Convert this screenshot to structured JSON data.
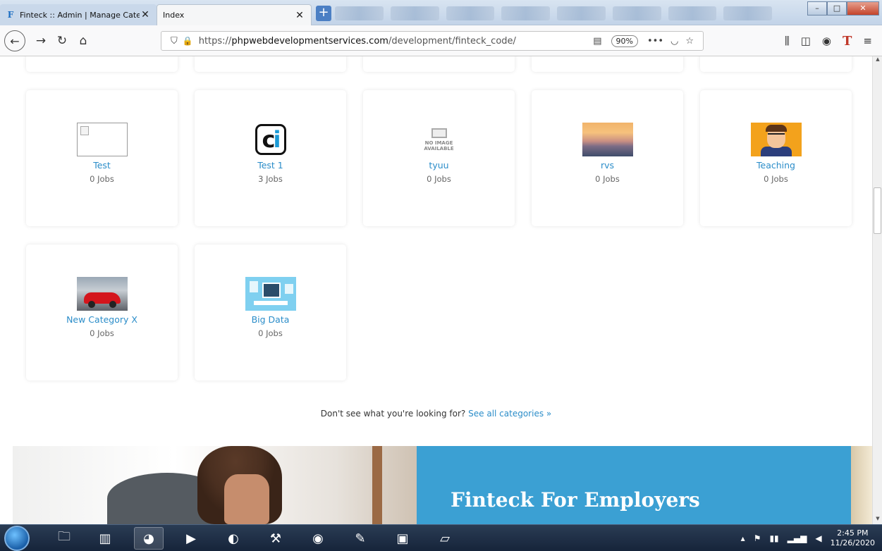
{
  "browser": {
    "tabs": [
      {
        "title": "Finteck :: Admin | Manage Cate",
        "active": false
      },
      {
        "title": "Index",
        "active": true
      }
    ],
    "url_prefix": "https://",
    "url_domain": "phpwebdevelopmentservices.com",
    "url_path": "/development/finteck_code/",
    "zoom": "90%"
  },
  "categories": [
    {
      "name": "Test",
      "jobs": "0 Jobs"
    },
    {
      "name": "Test 1",
      "jobs": "3 Jobs"
    },
    {
      "name": "tyuu",
      "jobs": "0 Jobs"
    },
    {
      "name": "rvs",
      "jobs": "0 Jobs"
    },
    {
      "name": "Teaching",
      "jobs": "0 Jobs"
    },
    {
      "name": "New Category X",
      "jobs": "0 Jobs"
    },
    {
      "name": "Big Data",
      "jobs": "0 Jobs"
    }
  ],
  "noimage": {
    "line1": "NO IMAGE",
    "line2": "AVAILABLE"
  },
  "see_all": {
    "prompt": "Don't see what you're looking for?",
    "link": "See all categories »"
  },
  "hero": {
    "title": "Finteck For Employers"
  },
  "taskbar": {
    "time": "2:45 PM",
    "date": "11/26/2020"
  },
  "colors": {
    "accent": "#2b8dc9",
    "hero_blue": "#3ba0d3"
  }
}
